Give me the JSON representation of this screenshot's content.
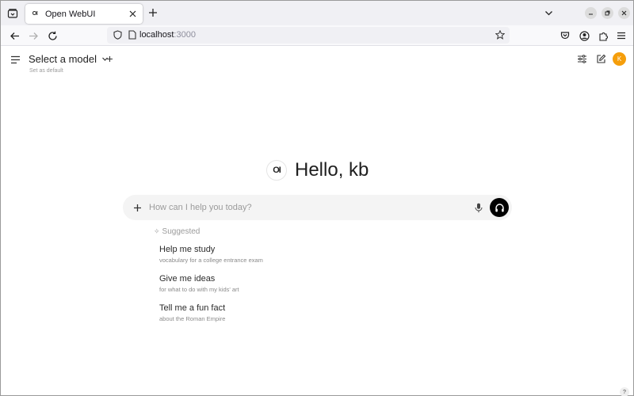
{
  "browser": {
    "tab_title": "Open WebUI",
    "favicon_text": "OI",
    "url_host": "localhost",
    "url_port": ":3000"
  },
  "header": {
    "model_label": "Select a model",
    "set_default": "Set as default",
    "avatar_initial": "K"
  },
  "greeting": {
    "logo_text": "OI",
    "text": "Hello, kb"
  },
  "chat": {
    "placeholder": "How can I help you today?"
  },
  "suggestions": {
    "header": "Suggested",
    "items": [
      {
        "title": "Help me study",
        "subtitle": "vocabulary for a college entrance exam"
      },
      {
        "title": "Give me ideas",
        "subtitle": "for what to do with my kids' art"
      },
      {
        "title": "Tell me a fun fact",
        "subtitle": "about the Roman Empire"
      }
    ]
  },
  "help": "?",
  "icons": [
    "tab-list-icon",
    "close-icon",
    "plus-icon",
    "chevron-down-icon",
    "minimize-icon",
    "maximize-icon",
    "back-arrow-icon",
    "forward-arrow-icon",
    "reload-icon",
    "shield-icon",
    "page-icon",
    "star-icon",
    "pocket-icon",
    "account-icon",
    "extensions-icon",
    "hamburger-menu-icon",
    "sliders-icon",
    "pencil-icon",
    "microphone-icon",
    "headphones-icon",
    "sparkle-icon"
  ],
  "colors": {
    "avatar": "#f59e0b",
    "voice_button": "#000000",
    "chatbox": "#f4f4f4"
  }
}
